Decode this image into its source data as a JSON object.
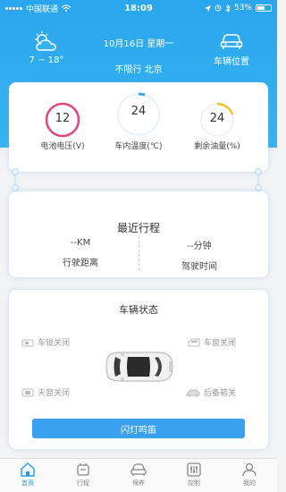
{
  "status_bar": {
    "carrier": "中国联通",
    "time": "18:09",
    "battery": "53%"
  },
  "header": {
    "weather_icon": "partly-cloudy-icon",
    "temperature": "7 ~ 18°",
    "date": "10月16日 星期一",
    "restriction": "不限行 北京",
    "car_position_label": "车辆位置",
    "background_color": "#2aa6ee"
  },
  "gauges": [
    {
      "value": "12",
      "label": "电池电压(V)",
      "color": "#e6447f"
    },
    {
      "value": "24",
      "label": "车内温度(℃)",
      "color": "#3ba8f0"
    },
    {
      "value": "24",
      "label": "剩余油量(%)",
      "color": "#f2c230"
    }
  ],
  "trip": {
    "title": "最近行程",
    "distance_value": "--KM",
    "distance_label": "行驶距离",
    "time_value": "--分钟",
    "time_label": "驾驶时间"
  },
  "vehicle_state": {
    "title": "车辆状态",
    "lock": "车锁关闭",
    "window": "车窗关闭",
    "sunroof": "天窗关闭",
    "trunk": "后备箱关",
    "flash_button": "闪灯鸣笛"
  },
  "tabbar": {
    "items": [
      {
        "label": "首页",
        "icon": "home-icon",
        "active": true
      },
      {
        "label": "行程",
        "icon": "trip-icon",
        "active": false
      },
      {
        "label": "保养",
        "icon": "maintenance-icon",
        "active": false
      },
      {
        "label": "控制",
        "icon": "control-icon",
        "active": false
      },
      {
        "label": "我的",
        "icon": "profile-icon",
        "active": false
      }
    ],
    "active_color": "#2a9ae8"
  }
}
